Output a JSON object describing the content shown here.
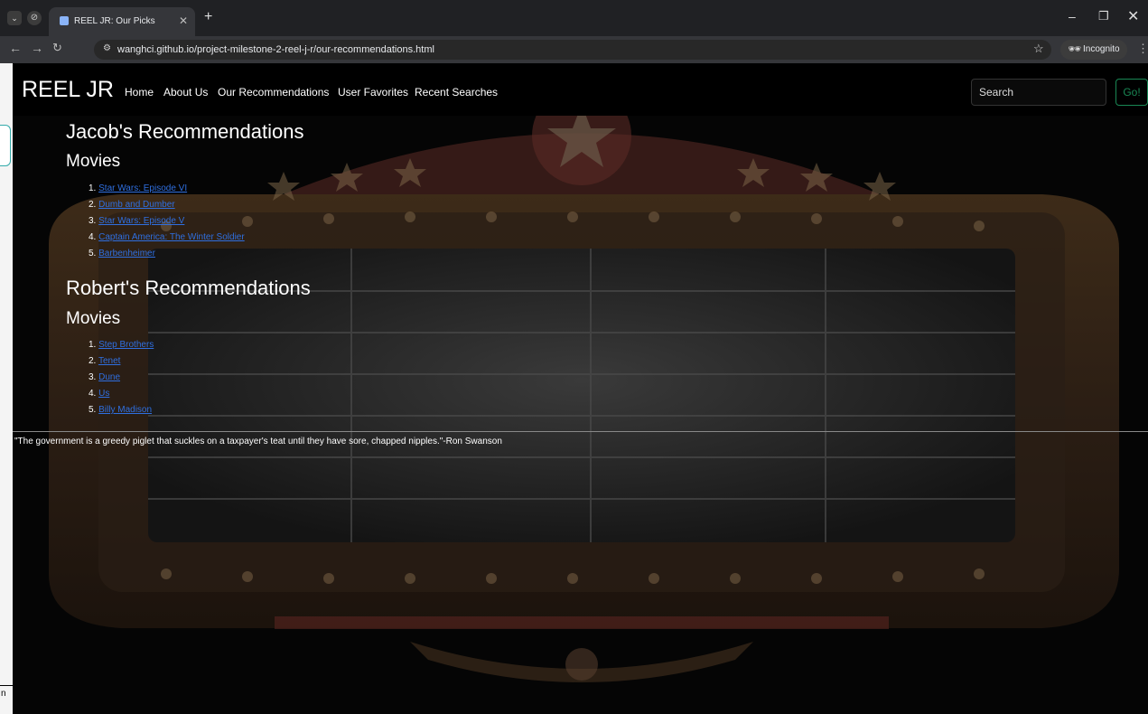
{
  "browser": {
    "tab_title": "REEL JR: Our Picks",
    "url": "wanghci.github.io/project-milestone-2-reel-j-r/our-recommendations.html",
    "incognito_label": "Incognito"
  },
  "navbar": {
    "brand": "REEL JR",
    "links": [
      "Home",
      "About Us",
      "Our Recommendations",
      "User Favorites",
      "Recent Searches"
    ],
    "search_placeholder": "Search",
    "go_label": "Go!"
  },
  "sections": [
    {
      "title": "Jacob's Recommendations",
      "subtitle": "Movies",
      "items": [
        {
          "num": "1.",
          "label": "Star Wars: Episode VI"
        },
        {
          "num": "2.",
          "label": "Dumb and Dumber"
        },
        {
          "num": "3.",
          "label": "Star Wars: Episode V"
        },
        {
          "num": "4.",
          "label": "Captain America: The Winter Soldier"
        },
        {
          "num": "5.",
          "label": "Barbenheimer"
        }
      ]
    },
    {
      "title": "Robert's Recommendations",
      "subtitle": "Movies",
      "items": [
        {
          "num": "1.",
          "label": "Step Brothers"
        },
        {
          "num": "2.",
          "label": "Tenet"
        },
        {
          "num": "3.",
          "label": "Dune"
        },
        {
          "num": "4.",
          "label": "Us"
        },
        {
          "num": "5.",
          "label": "Billy Madison"
        }
      ]
    }
  ],
  "footer": {
    "quote": "\"The government is a greedy piglet that suckles on a taxpayer's teat until they have sore, chapped nipples.\"-Ron Swanson"
  },
  "colors": {
    "link": "#2f6fe0",
    "go_button": "#198754",
    "page_background": "#000000"
  }
}
